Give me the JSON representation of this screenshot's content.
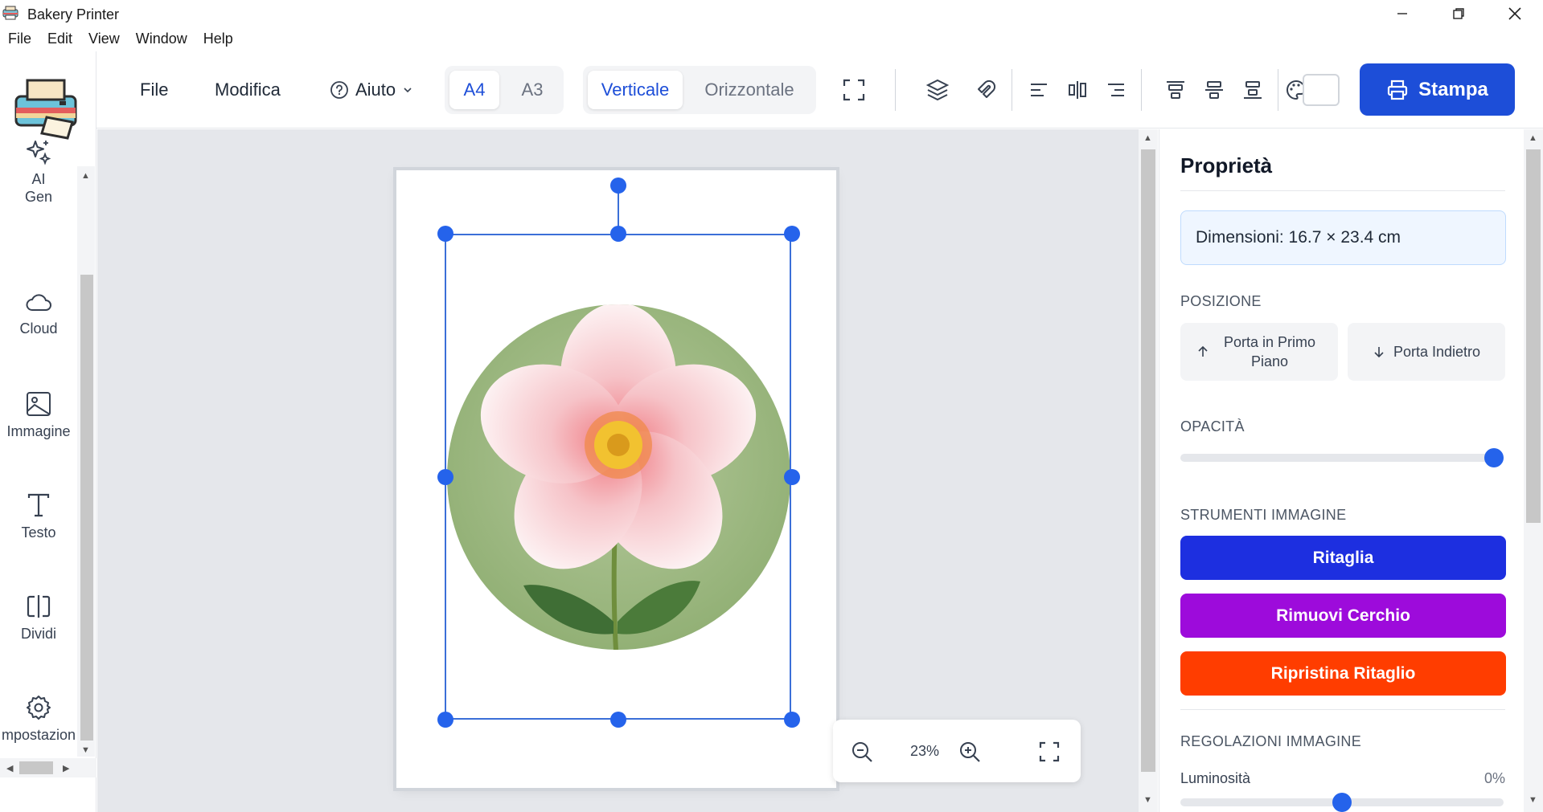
{
  "window": {
    "title": "Bakery Printer"
  },
  "menubar": {
    "items": [
      "File",
      "Edit",
      "View",
      "Window",
      "Help"
    ]
  },
  "toolbar": {
    "file_label": "File",
    "edit_label": "Modifica",
    "help_label": "Aiuto",
    "paper_sizes": [
      "A4",
      "A3"
    ],
    "paper_selected": "A4",
    "orientations": [
      "Verticale",
      "Orizzontale"
    ],
    "orientation_selected": "Verticale",
    "print_label": "Stampa"
  },
  "sidebar": {
    "items": [
      {
        "label": "AI\nGen",
        "icon": "sparkles-icon"
      },
      {
        "label": "Cloud",
        "icon": "cloud-icon"
      },
      {
        "label": "Immagine",
        "icon": "image-icon"
      },
      {
        "label": "Testo",
        "icon": "text-icon"
      },
      {
        "label": "Dividi",
        "icon": "split-icon"
      },
      {
        "label": "mpostazion",
        "icon": "gear-icon"
      }
    ]
  },
  "canvas": {
    "zoom": "23%"
  },
  "panel": {
    "title": "Proprietà",
    "dimensions": "Dimensioni: 16.7 × 23.4 cm",
    "position_label": "POSIZIONE",
    "bring_front": "Porta in Primo Piano",
    "send_back": "Porta Indietro",
    "opacity_label": "OPACITÀ",
    "opacity_value": 1.0,
    "image_tools_label": "STRUMENTI IMMAGINE",
    "crop": "Ritaglia",
    "remove_circle": "Rimuovi Cerchio",
    "reset_crop": "Ripristina Ritaglio",
    "adjust_label": "REGOLAZIONI IMMAGINE",
    "brightness_label": "Luminosità",
    "brightness_value": "0%",
    "brightness_fraction": 0.5
  },
  "colors": {
    "accent": "#1d4ed8",
    "crop_button": "#1d2fe0",
    "remove_circle_button": "#9d0bdb",
    "reset_crop_button": "#ff3d00"
  }
}
